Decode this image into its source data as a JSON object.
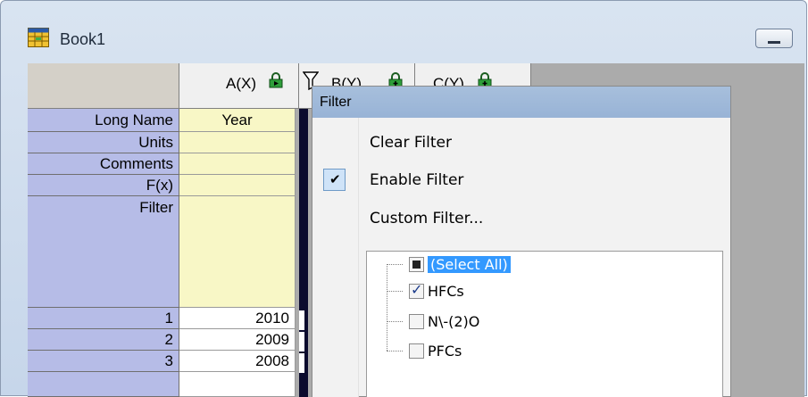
{
  "window": {
    "title": "Book1",
    "icon": "workbook-grid-icon"
  },
  "columns": [
    {
      "label": "A(X)"
    },
    {
      "label": "B(Y)"
    },
    {
      "label": "C(Y)"
    }
  ],
  "row_headers": {
    "long_name": "Long Name",
    "units": "Units",
    "comments": "Comments",
    "fx": "F(x)",
    "filter": "Filter"
  },
  "meta_values": {
    "long_name_a": "Year"
  },
  "data_rows": [
    {
      "index": "1",
      "a": "2010"
    },
    {
      "index": "2",
      "a": "2009"
    },
    {
      "index": "3",
      "a": "2008"
    }
  ],
  "filter_menu": {
    "title": "Filter",
    "items": [
      {
        "label": "Clear Filter",
        "checked": false
      },
      {
        "label": "Enable Filter",
        "checked": true
      },
      {
        "label": "Custom Filter...",
        "checked": false
      }
    ],
    "values": [
      {
        "label": "(Select All)",
        "state": "partial"
      },
      {
        "label": "HFCs",
        "state": "checked"
      },
      {
        "label": "N\\-(2)O",
        "state": "unchecked"
      },
      {
        "label": "PFCs",
        "state": "unchecked"
      }
    ]
  },
  "colors": {
    "row_header": "#b6bce7",
    "meta_cell": "#f8f7c6",
    "menu_title": "#a7bfdc",
    "selection": "#3399ff"
  }
}
